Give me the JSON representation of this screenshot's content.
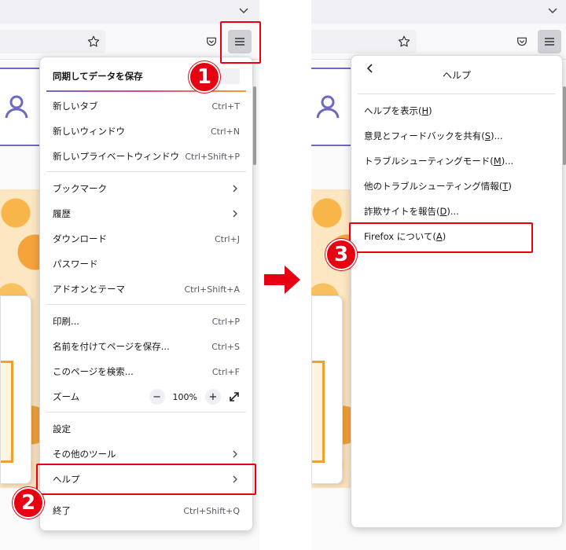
{
  "colors": {
    "highlight": "#e60012",
    "accent_purple": "#6d69c3",
    "menu_text": "#15141a",
    "shortcut_text": "#5b5b66"
  },
  "icons": {
    "tabstrip": "chevron-down-icon",
    "bookmark": "star-icon",
    "pocket": "pocket-icon",
    "menu": "hamburger-menu-icon",
    "account": "user-icon",
    "submenu": "chevron-right-icon",
    "back": "chevron-left-icon",
    "fullscreen": "expand-icon",
    "step_arrow": "arrow-right-icon"
  },
  "main_menu": {
    "sync_header": "同期してデータを保存",
    "items": [
      {
        "label": "新しいタブ",
        "shortcut": "Ctrl+T"
      },
      {
        "label": "新しいウィンドウ",
        "shortcut": "Ctrl+N"
      },
      {
        "label": "新しいプライベートウィンドウ",
        "shortcut": "Ctrl+Shift+P"
      },
      {
        "label": "ブックマーク",
        "shortcut": ""
      },
      {
        "label": "履歴",
        "shortcut": ""
      },
      {
        "label": "ダウンロード",
        "shortcut": "Ctrl+J"
      },
      {
        "label": "パスワード",
        "shortcut": ""
      },
      {
        "label": "アドオンとテーマ",
        "shortcut": "Ctrl+Shift+A"
      },
      {
        "label": "印刷...",
        "shortcut": "Ctrl+P"
      },
      {
        "label": "名前を付けてページを保存...",
        "shortcut": "Ctrl+S"
      },
      {
        "label": "このページを検索...",
        "shortcut": "Ctrl+F"
      },
      {
        "label": "ズーム",
        "shortcut": ""
      },
      {
        "label": "設定",
        "shortcut": ""
      },
      {
        "label": "その他のツール",
        "shortcut": ""
      },
      {
        "label": "ヘルプ",
        "shortcut": ""
      },
      {
        "label": "終了",
        "shortcut": "Ctrl+Shift+Q"
      }
    ],
    "zoom": {
      "minus": "−",
      "value": "100%",
      "plus": "+"
    }
  },
  "help_menu": {
    "title": "ヘルプ",
    "items": [
      {
        "label": "ヘルプを表示(",
        "key": "H",
        "end": ")"
      },
      {
        "label": "意見とフィードバックを共有(",
        "key": "S",
        "end": ")..."
      },
      {
        "label": "トラブルシューティングモード(",
        "key": "M",
        "end": ")..."
      },
      {
        "label": "他のトラブルシューティング情報(",
        "key": "T",
        "end": ")"
      },
      {
        "label": "詐欺サイトを報告(",
        "key": "D",
        "end": ")..."
      },
      {
        "label": "Firefox について(",
        "key": "A",
        "end": ")"
      }
    ]
  },
  "steps": {
    "one": "1",
    "two": "2",
    "three": "3"
  }
}
